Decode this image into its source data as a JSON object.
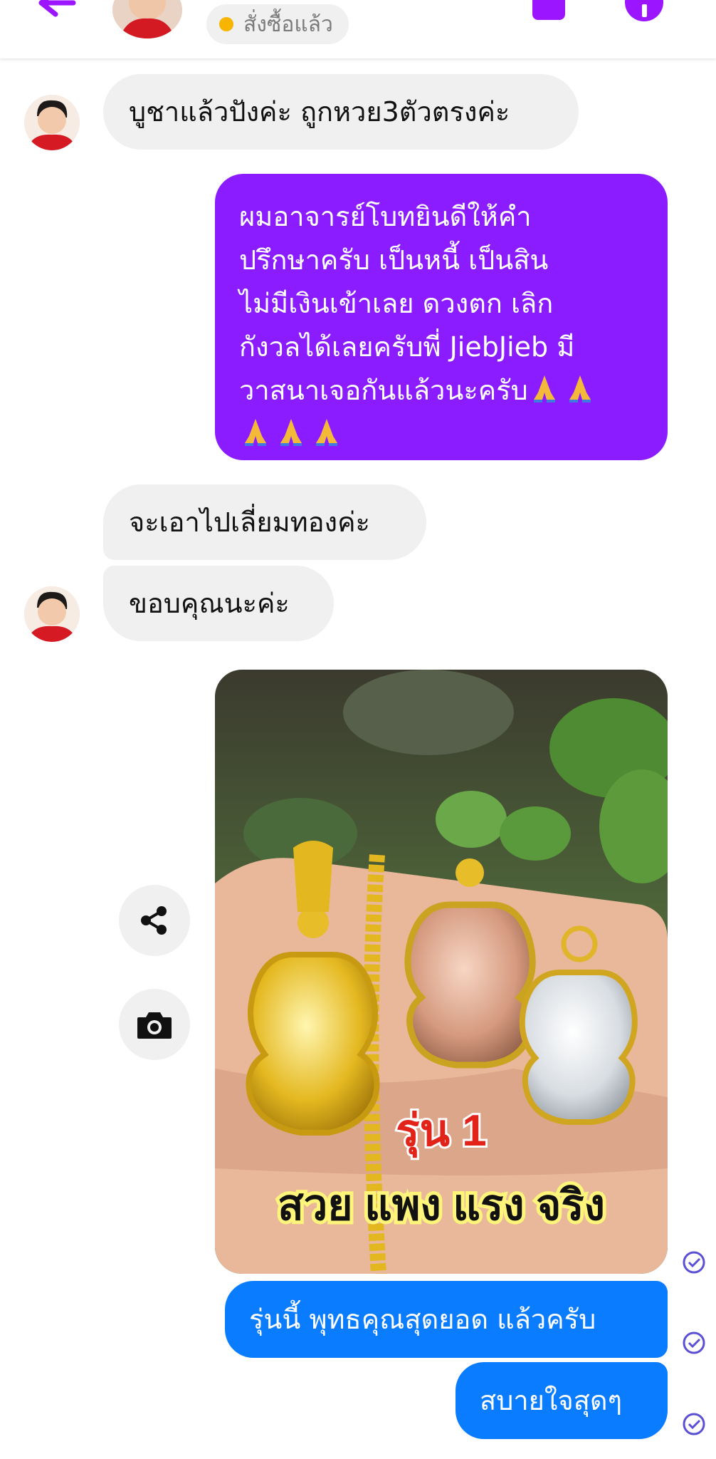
{
  "header": {
    "status_label": "สั่งซื้อแล้ว",
    "accent_color": "#9b16ff",
    "status_dot_color": "#f7b500",
    "back_icon": "back-arrow-icon",
    "call_icon": "phone-icon",
    "info_icon": "info-icon"
  },
  "messages": [
    {
      "side": "incoming",
      "text": "บูชาแล้วปังค่ะ ถูกหวย3ตัวตรงค่ะ"
    },
    {
      "side": "outgoing",
      "lines": [
        "ผมอาจารย์โบทยินดีให้คำ",
        "ปรึกษาครับ เป็นหนี้ เป็นสิน",
        "ไม่มีเงินเข้าเลย ดวงตก เลิก",
        "กังวลได้เลยครับพี่ JiebJieb  มี",
        "วาสนาเจอกันแล้วนะครับ"
      ],
      "emoji": "folded-hands-emoji"
    },
    {
      "side": "incoming",
      "text": "จะเอาไปเลี่ยมทองค่ะ"
    },
    {
      "side": "incoming",
      "text": "ขอบคุณนะค่ะ"
    },
    {
      "side": "outgoing",
      "type": "image",
      "caption_line1": "รุ่น 1",
      "caption_line2": "สวย แพง แรง จริง"
    },
    {
      "side": "outgoing",
      "text": "รุ่นนี้ พุทธคุณสุดยอด แล้วครับ"
    },
    {
      "side": "outgoing",
      "text": "สบายใจสุดๆ"
    }
  ],
  "actions": {
    "share_icon": "share-icon",
    "camera_icon": "camera-icon"
  },
  "colors": {
    "incoming_bubble": "#f0f0f0",
    "outgoing_purple": "#8a1cff",
    "outgoing_blue": "#0a7cff",
    "read_check": "#5b4fd6"
  }
}
